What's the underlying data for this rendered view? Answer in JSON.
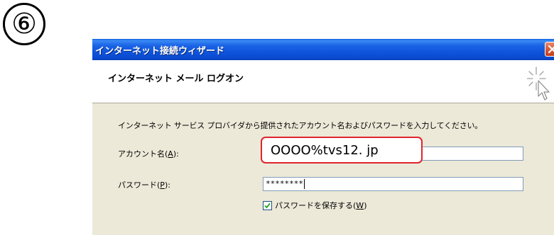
{
  "step_marker": "⑥",
  "window": {
    "title": "インターネット接続ウィザード"
  },
  "header": {
    "title": "インターネット メール ログオン"
  },
  "content": {
    "instruction": "インターネット サービス プロバイダから提供されたアカウント名およびパスワードを入力してください。",
    "account": {
      "label": "アカウント名",
      "accesskey": "A",
      "value": "OOOO%tvs12. jp"
    },
    "password": {
      "label": "パスワード",
      "accesskey": "P",
      "value": "********"
    },
    "remember_password": {
      "label": "パスワードを保存する",
      "accesskey": "W",
      "checked": true
    }
  },
  "colors": {
    "titlebar": "#0a4cd3",
    "dialog_background": "#ece9d8",
    "highlight_border": "#e0242c",
    "close_button": "#d6502d"
  },
  "icons": [
    "wizard-sparkle-cursor-icon",
    "close-icon",
    "checkmark-icon"
  ]
}
